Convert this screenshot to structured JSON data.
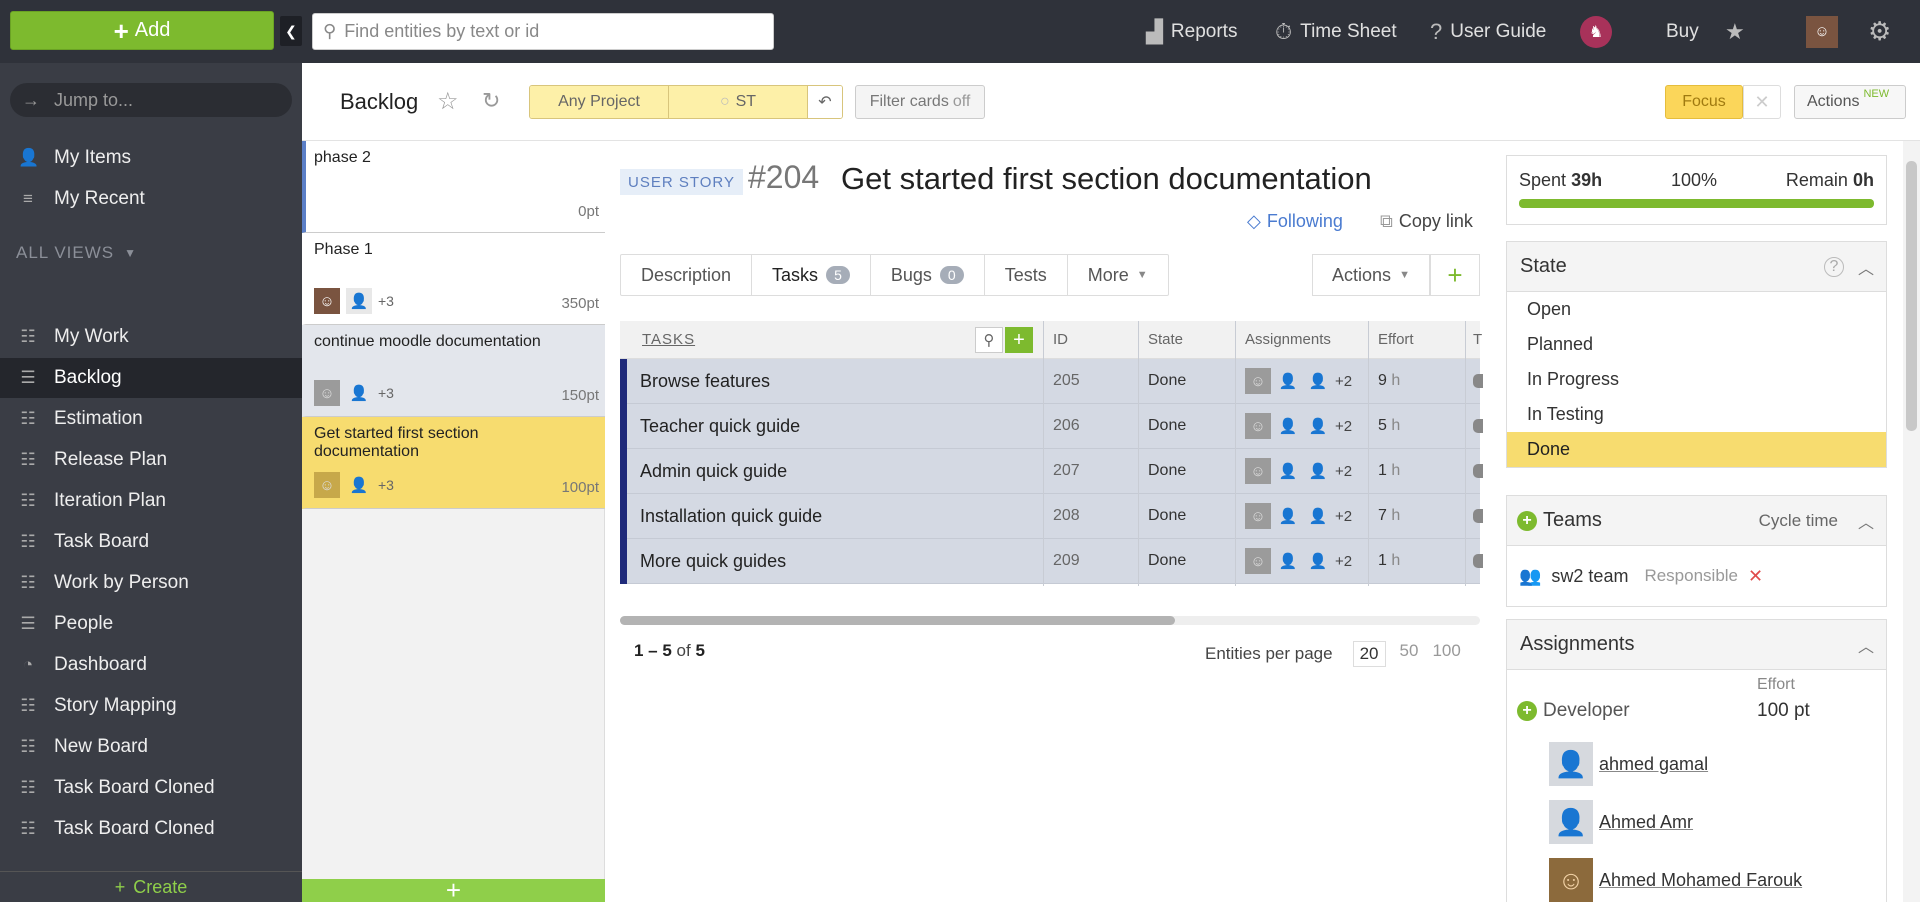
{
  "topbar": {
    "add_label": "Add",
    "search_placeholder": "Find entities by text or id",
    "reports": "Reports",
    "timesheet": "Time Sheet",
    "guide": "User Guide",
    "buy": "Buy"
  },
  "sidebar": {
    "jump_placeholder": "Jump to...",
    "my_items": "My Items",
    "my_recent": "My Recent",
    "views_header": "ALL VIEWS",
    "views": [
      {
        "label": "My Work",
        "icon": "board-icon"
      },
      {
        "label": "Backlog",
        "icon": "list-icon",
        "active": true
      },
      {
        "label": "Estimation",
        "icon": "board-icon"
      },
      {
        "label": "Release Plan",
        "icon": "board-icon"
      },
      {
        "label": "Iteration Plan",
        "icon": "board-icon"
      },
      {
        "label": "Task Board",
        "icon": "board-icon"
      },
      {
        "label": "Work by Person",
        "icon": "board-icon"
      },
      {
        "label": "People",
        "icon": "list-icon"
      },
      {
        "label": "Dashboard",
        "icon": "dashboard-icon"
      },
      {
        "label": "Story Mapping",
        "icon": "board-lock-icon"
      },
      {
        "label": "New Board",
        "icon": "board-lock-icon"
      },
      {
        "label": "Task Board Cloned",
        "icon": "board-lock-icon"
      },
      {
        "label": "Task Board Cloned",
        "icon": "board-lock-icon"
      }
    ],
    "create_label": "Create"
  },
  "pagebar": {
    "title": "Backlog",
    "project_filter": "Any Project",
    "st_filter": "ST",
    "filter_cards": "Filter cards",
    "filter_cards_state": "off",
    "focus": "Focus",
    "actions": "Actions",
    "actions_badge": "NEW"
  },
  "cards": [
    {
      "title": "phase 2",
      "points": "0",
      "unit": "pt",
      "extra": ""
    },
    {
      "title": "Phase 1",
      "points": "350",
      "unit": "pt",
      "extra": "+3"
    },
    {
      "title": "continue moodle documentation",
      "points": "150",
      "unit": "pt",
      "extra": "+3"
    },
    {
      "title": "Get started first section documentation",
      "points": "100",
      "unit": "pt",
      "extra": "+3"
    }
  ],
  "detail": {
    "type_badge": "USER STORY",
    "id": "#204",
    "title": "Get started first section documentation",
    "following": "Following",
    "copy_link": "Copy link",
    "tabs": {
      "description": "Description",
      "tasks": "Tasks",
      "tasks_count": "5",
      "bugs": "Bugs",
      "bugs_count": "0",
      "tests": "Tests",
      "more": "More",
      "actions": "Actions"
    },
    "table": {
      "headers": {
        "tasks": "TASKS",
        "id": "ID",
        "state": "State",
        "assignments": "Assignments",
        "effort": "Effort",
        "t": "T"
      },
      "rows": [
        {
          "name": "Browse features",
          "id": "205",
          "state": "Done",
          "extra": "+2",
          "effort": "9",
          "unit": "h"
        },
        {
          "name": "Teacher quick guide",
          "id": "206",
          "state": "Done",
          "extra": "+2",
          "effort": "5",
          "unit": "h"
        },
        {
          "name": "Admin quick guide",
          "id": "207",
          "state": "Done",
          "extra": "+2",
          "effort": "1",
          "unit": "h"
        },
        {
          "name": "Installation quick guide",
          "id": "208",
          "state": "Done",
          "extra": "+2",
          "effort": "7",
          "unit": "h"
        },
        {
          "name": "More quick guides",
          "id": "209",
          "state": "Done",
          "extra": "+2",
          "effort": "1",
          "unit": "h"
        }
      ]
    },
    "pager": {
      "range": "1 – 5",
      "of": "of",
      "total": "5",
      "per_page_label": "Entities per page",
      "options": [
        "20",
        "50",
        "100"
      ],
      "selected": "20"
    }
  },
  "right": {
    "spent_label": "Spent",
    "spent_value": "39h",
    "percent": "100%",
    "remain_label": "Remain",
    "remain_value": "0h",
    "progress": 1.0,
    "state_header": "State",
    "states": [
      "Open",
      "Planned",
      "In Progress",
      "In Testing",
      "Done"
    ],
    "current_state": "Done",
    "teams_header": "Teams",
    "cycle_time": "Cycle time",
    "team_name": "sw2 team",
    "team_role": "Responsible",
    "assignments_header": "Assignments",
    "effort_col": "Effort",
    "role": "Developer",
    "role_effort": "100 pt",
    "people": [
      "ahmed gamal",
      "Ahmed Amr",
      "Ahmed Mohamed Farouk"
    ]
  }
}
